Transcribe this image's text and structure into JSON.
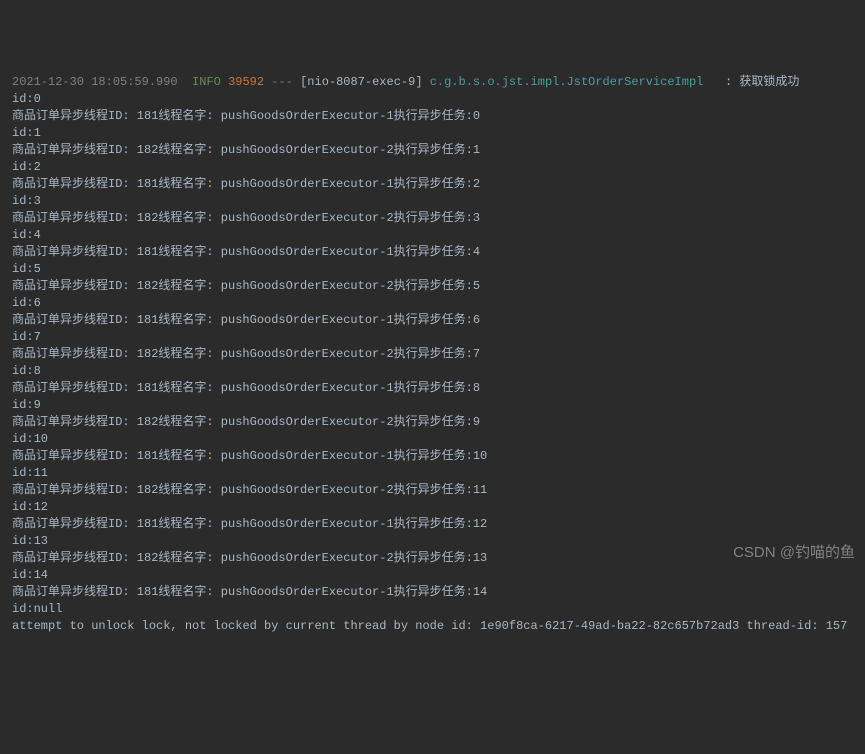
{
  "header": {
    "timestamp": "2021-12-30 18:05:59.990",
    "level": "INFO",
    "pid": "39592",
    "separator": "---",
    "thread": "[nio-8087-exec-9]",
    "classname": "c.g.b.s.o.jst.impl.JstOrderServiceImpl",
    "colon": ":",
    "message": "获取锁成功"
  },
  "lines": [
    "id:0",
    "商品订单异步线程ID: 181线程名字: pushGoodsOrderExecutor-1执行异步任务:0",
    "id:1",
    "商品订单异步线程ID: 182线程名字: pushGoodsOrderExecutor-2执行异步任务:1",
    "id:2",
    "商品订单异步线程ID: 181线程名字: pushGoodsOrderExecutor-1执行异步任务:2",
    "id:3",
    "商品订单异步线程ID: 182线程名字: pushGoodsOrderExecutor-2执行异步任务:3",
    "id:4",
    "商品订单异步线程ID: 181线程名字: pushGoodsOrderExecutor-1执行异步任务:4",
    "id:5",
    "商品订单异步线程ID: 182线程名字: pushGoodsOrderExecutor-2执行异步任务:5",
    "id:6",
    "商品订单异步线程ID: 181线程名字: pushGoodsOrderExecutor-1执行异步任务:6",
    "id:7",
    "商品订单异步线程ID: 182线程名字: pushGoodsOrderExecutor-2执行异步任务:7",
    "id:8",
    "商品订单异步线程ID: 181线程名字: pushGoodsOrderExecutor-1执行异步任务:8",
    "id:9",
    "商品订单异步线程ID: 182线程名字: pushGoodsOrderExecutor-2执行异步任务:9",
    "id:10",
    "商品订单异步线程ID: 181线程名字: pushGoodsOrderExecutor-1执行异步任务:10",
    "id:11",
    "商品订单异步线程ID: 182线程名字: pushGoodsOrderExecutor-2执行异步任务:11",
    "id:12",
    "商品订单异步线程ID: 181线程名字: pushGoodsOrderExecutor-1执行异步任务:12",
    "id:13",
    "商品订单异步线程ID: 182线程名字: pushGoodsOrderExecutor-2执行异步任务:13",
    "id:14",
    "商品订单异步线程ID: 181线程名字: pushGoodsOrderExecutor-1执行异步任务:14",
    "id:null",
    "attempt to unlock lock, not locked by current thread by node id: 1e90f8ca-6217-49ad-ba22-82c657b72ad3 thread-id: 157"
  ],
  "watermark": "CSDN @钓喵的鱼"
}
